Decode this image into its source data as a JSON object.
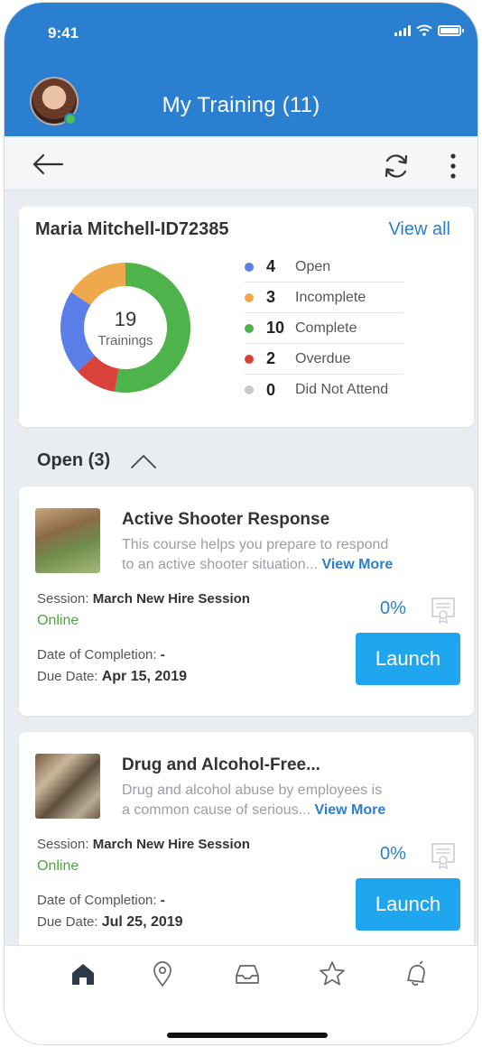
{
  "status_bar": {
    "time": "9:41"
  },
  "header": {
    "title": "My Training (11)"
  },
  "colors": {
    "primary": "#2a7fd1",
    "open": "#5b7fe8",
    "incomplete": "#efa84c",
    "complete": "#4db34a",
    "overdue": "#d9413a",
    "did_not_attend": "#c4c7cb",
    "launch": "#1fa6ee",
    "online": "#4aaa3f"
  },
  "summary": {
    "user": "Maria Mitchell-ID72385",
    "view_all": "View all",
    "total": "19",
    "total_label": "Trainings",
    "legend": [
      {
        "count": "4",
        "label": "Open",
        "value": 4
      },
      {
        "count": "3",
        "label": "Incomplete",
        "value": 3
      },
      {
        "count": "10",
        "label": "Complete",
        "value": 10
      },
      {
        "count": "2",
        "label": "Overdue",
        "value": 2
      },
      {
        "count": "0",
        "label": "Did Not Attend",
        "value": 0
      }
    ]
  },
  "section": {
    "title": "Open (3)"
  },
  "courses": [
    {
      "title": "Active Shooter Response",
      "desc_line1": "This course helps you prepare to respond",
      "desc_line2": "to an active shooter situation...",
      "view_more": "View More",
      "session_label": "Session:",
      "session": "March New Hire Session",
      "mode": "Online",
      "percent": "0%",
      "completion_label": "Date of Completion:",
      "completion": "-",
      "due_label": "Due Date:",
      "due": "Apr 15, 2019",
      "launch": "Launch"
    },
    {
      "title": "Drug and Alcohol-Free...",
      "desc_line1": "Drug and alcohol abuse by employees is",
      "desc_line2": "a common cause of serious...",
      "view_more": "View More",
      "session_label": "Session:",
      "session": "March New Hire Session",
      "mode": "Online",
      "percent": "0%",
      "completion_label": "Date of Completion:",
      "completion": "-",
      "due_label": "Due Date:",
      "due": "Jul 25, 2019",
      "launch": "Launch"
    }
  ],
  "tabs": [
    "home-icon",
    "location-pin-icon",
    "inbox-icon",
    "star-icon",
    "bell-icon"
  ]
}
